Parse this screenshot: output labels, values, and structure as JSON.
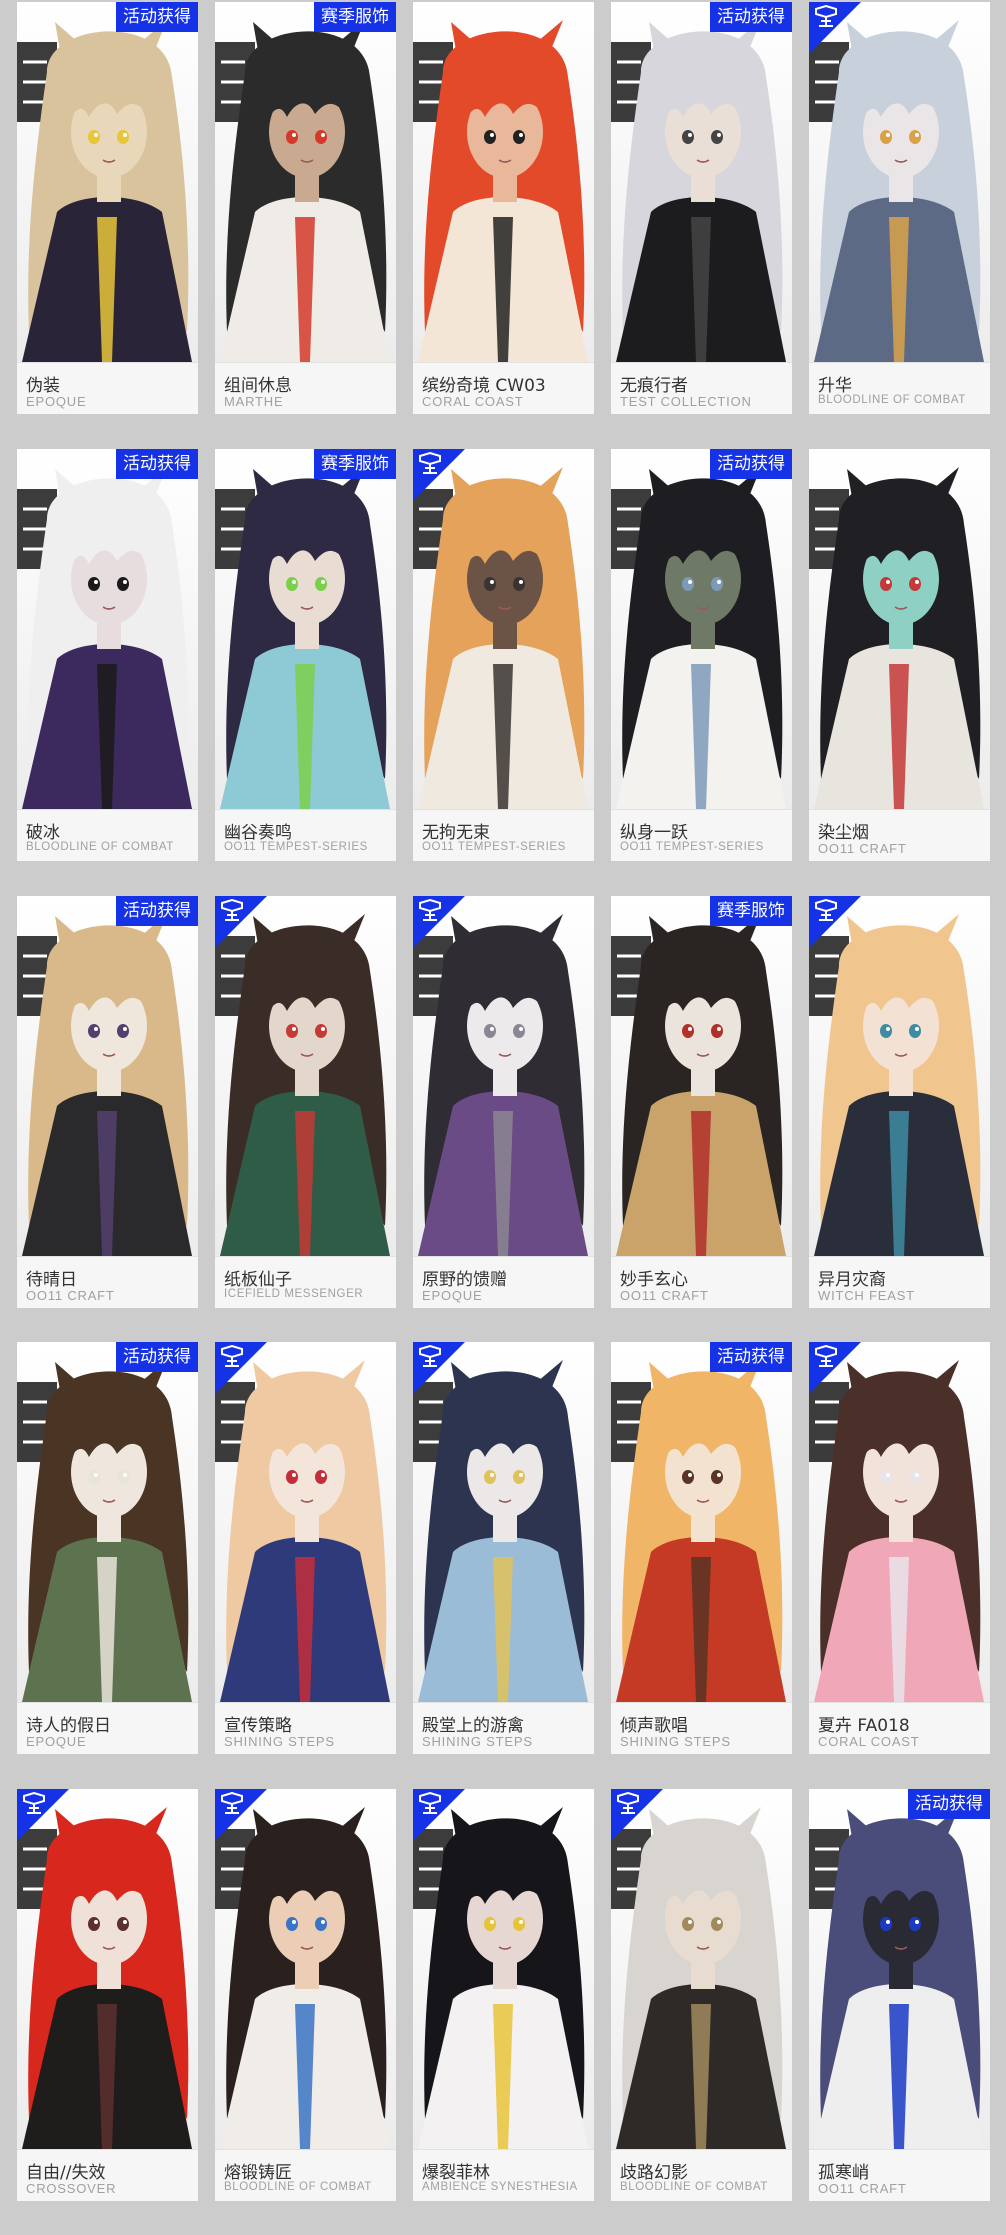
{
  "cards": [
    {
      "name": "伪装",
      "series": "EPOQUE",
      "badge": "活动获得",
      "corner": false,
      "palette": [
        "#d9c39c",
        "#2a2438",
        "#e8d7b8",
        "#e8c53a"
      ]
    },
    {
      "name": "组间休息",
      "series": "MARTHE",
      "badge": "赛季服饰",
      "corner": false,
      "palette": [
        "#2b2b2b",
        "#efece8",
        "#c9a98f",
        "#d23a2a"
      ]
    },
    {
      "name": "缤纷奇境 CW03",
      "series": "CORAL COAST",
      "badge": "",
      "corner": false,
      "palette": [
        "#e24a2a",
        "#f3e6d6",
        "#e9b79a",
        "#222222"
      ]
    },
    {
      "name": "无痕行者",
      "series": "TEST COLLECTION",
      "badge": "活动获得",
      "corner": false,
      "palette": [
        "#d6d6dc",
        "#1c1c1f",
        "#eadfd6",
        "#444444"
      ]
    },
    {
      "name": "升华",
      "series": "BLOODLINE OF COMBAT",
      "badge": "",
      "corner": true,
      "palette": [
        "#c8d0dc",
        "#5c6a86",
        "#eae6e8",
        "#d9a24a"
      ]
    },
    {
      "name": "破冰",
      "series": "BLOODLINE OF COMBAT",
      "badge": "活动获得",
      "corner": false,
      "palette": [
        "#efefef",
        "#3c2a5e",
        "#e7dcde",
        "#1a1a1a"
      ]
    },
    {
      "name": "幽谷奏鸣",
      "series": "OO11 TEMPEST-SERIES",
      "badge": "赛季服饰",
      "corner": false,
      "palette": [
        "#2e2a44",
        "#8ec9d6",
        "#e9dcd2",
        "#7bd04a"
      ]
    },
    {
      "name": "无拘无束",
      "series": "OO11 TEMPEST-SERIES",
      "badge": "",
      "corner": true,
      "palette": [
        "#e5a25a",
        "#efe9e0",
        "#6b5446",
        "#3a3431"
      ]
    },
    {
      "name": "纵身一跃",
      "series": "OO11 TEMPEST-SERIES",
      "badge": "活动获得",
      "corner": false,
      "palette": [
        "#1e1e22",
        "#f4f2ee",
        "#6f7a66",
        "#7c9ab8"
      ]
    },
    {
      "name": "染尘烟",
      "series": "OO11 CRAFT",
      "badge": "",
      "corner": false,
      "palette": [
        "#202024",
        "#e8e4de",
        "#8fd0c4",
        "#c43a3a"
      ]
    },
    {
      "name": "待晴日",
      "series": "OO11 CRAFT",
      "badge": "活动获得",
      "corner": false,
      "palette": [
        "#d9b98a",
        "#2a2a2c",
        "#efe6dc",
        "#54406e"
      ]
    },
    {
      "name": "纸板仙子",
      "series": "ICEFIELD MESSENGER",
      "badge": "",
      "corner": true,
      "palette": [
        "#3a2c26",
        "#2f5c46",
        "#e3d6cb",
        "#c43a36"
      ]
    },
    {
      "name": "原野的馈赠",
      "series": "EPOQUE",
      "badge": "",
      "corner": true,
      "palette": [
        "#2f2d33",
        "#6b4b86",
        "#eceaea",
        "#8b8792"
      ]
    },
    {
      "name": "妙手玄心",
      "series": "OO11 CRAFT",
      "badge": "赛季服饰",
      "corner": false,
      "palette": [
        "#2a2522",
        "#c9a36a",
        "#ebe4dc",
        "#b0302a"
      ]
    },
    {
      "name": "异月灾裔",
      "series": "WITCH FEAST",
      "badge": "",
      "corner": true,
      "palette": [
        "#f1c68e",
        "#2a2e3a",
        "#f3e1d4",
        "#3e8ca4"
      ]
    },
    {
      "name": "诗人的假日",
      "series": "EPOQUE",
      "badge": "活动获得",
      "corner": false,
      "palette": [
        "#4a3424",
        "#5d7350",
        "#efe7de",
        "#e9e4da"
      ]
    },
    {
      "name": "宣传策略",
      "series": "SHINING STEPS",
      "badge": "",
      "corner": true,
      "palette": [
        "#eec9a2",
        "#2e3a7a",
        "#f3e5da",
        "#c42e3a"
      ]
    },
    {
      "name": "殿堂上的游禽",
      "series": "SHINING STEPS",
      "badge": "",
      "corner": true,
      "palette": [
        "#2c3450",
        "#9bbcd6",
        "#ece8e8",
        "#e0c25a"
      ]
    },
    {
      "name": "倾声歌唱",
      "series": "SHINING STEPS",
      "badge": "活动获得",
      "corner": false,
      "palette": [
        "#f0b567",
        "#c43a24",
        "#f3e2d0",
        "#5a3424"
      ]
    },
    {
      "name": "夏卉 FA018",
      "series": "CORAL COAST",
      "badge": "",
      "corner": true,
      "palette": [
        "#4a3028",
        "#f0a8b8",
        "#f1e2da",
        "#e9e4e9"
      ]
    },
    {
      "name": "自由//失效",
      "series": "CROSSOVER",
      "badge": "",
      "corner": true,
      "palette": [
        "#d8281e",
        "#1f1c1c",
        "#efe1d8",
        "#5d2f2f"
      ]
    },
    {
      "name": "熔锻铸匠",
      "series": "BLOODLINE OF COMBAT",
      "badge": "",
      "corner": true,
      "palette": [
        "#2a201e",
        "#f0ece8",
        "#eccdb6",
        "#3a74c4"
      ]
    },
    {
      "name": "爆裂菲林",
      "series": "AMBIENCE SYNESTHESIA",
      "badge": "",
      "corner": true,
      "palette": [
        "#16161a",
        "#f3f1f1",
        "#e6d7d2",
        "#e6c43a"
      ]
    },
    {
      "name": "歧路幻影",
      "series": "BLOODLINE OF COMBAT",
      "badge": "",
      "corner": true,
      "palette": [
        "#d8d5d1",
        "#2e2a28",
        "#e8dcd0",
        "#a08a5e"
      ]
    },
    {
      "name": "孤寒峭",
      "series": "OO11 CRAFT",
      "badge": "活动获得",
      "corner": false,
      "palette": [
        "#4a4c7a",
        "#eeeeef",
        "#2a2a34",
        "#1a3ac4"
      ]
    }
  ]
}
